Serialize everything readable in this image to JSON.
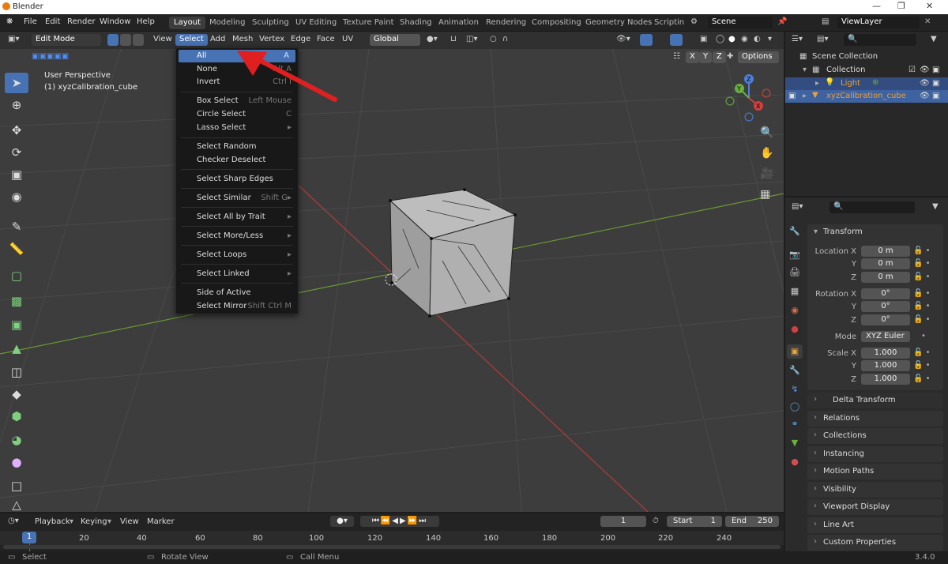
{
  "window": {
    "title": "Blender"
  },
  "menubar": {
    "items": [
      "File",
      "Edit",
      "Render",
      "Window",
      "Help"
    ],
    "workspaces": [
      "Layout",
      "Modeling",
      "Sculpting",
      "UV Editing",
      "Texture Paint",
      "Shading",
      "Animation",
      "Rendering",
      "Compositing",
      "Geometry Nodes",
      "Scripting"
    ],
    "active_workspace": "Layout",
    "scene": "Scene",
    "view_layer": "ViewLayer"
  },
  "header3d": {
    "mode": "Edit Mode",
    "menus": [
      "View",
      "Select",
      "Add",
      "Mesh",
      "Vertex",
      "Edge",
      "Face",
      "UV"
    ],
    "active_menu": "Select",
    "orientation": "Global",
    "options": "Options",
    "axes": [
      "X",
      "Y",
      "Z"
    ]
  },
  "viewport": {
    "perspective": "User Perspective",
    "object_label": "(1) xyzCalibration_cube"
  },
  "select_menu": {
    "items": [
      {
        "label": "All",
        "shortcut": "A",
        "highlighted": true
      },
      {
        "label": "None",
        "shortcut": "Alt A"
      },
      {
        "label": "Invert",
        "shortcut": "Ctrl I"
      },
      {
        "sep": true
      },
      {
        "label": "Box Select",
        "shortcut": "Left Mouse"
      },
      {
        "label": "Circle Select",
        "shortcut": "C"
      },
      {
        "label": "Lasso Select",
        "shortcut": "▸"
      },
      {
        "sep": true
      },
      {
        "label": "Select Random",
        "shortcut": ""
      },
      {
        "label": "Checker Deselect",
        "shortcut": ""
      },
      {
        "sep": true
      },
      {
        "label": "Select Sharp Edges",
        "shortcut": ""
      },
      {
        "sep": true
      },
      {
        "label": "Select Similar",
        "shortcut": "Shift G▸"
      },
      {
        "sep": true
      },
      {
        "label": "Select All by Trait",
        "shortcut": "▸"
      },
      {
        "sep": true
      },
      {
        "label": "Select More/Less",
        "shortcut": "▸"
      },
      {
        "sep": true
      },
      {
        "label": "Select Loops",
        "shortcut": "▸"
      },
      {
        "sep": true
      },
      {
        "label": "Select Linked",
        "shortcut": "▸"
      },
      {
        "sep": true
      },
      {
        "label": "Side of Active",
        "shortcut": ""
      },
      {
        "label": "Select Mirror",
        "shortcut": "Shift Ctrl M"
      }
    ]
  },
  "outliner": {
    "root": "Scene Collection",
    "collection": "Collection",
    "items": [
      "Light",
      "xyzCalibration_cube"
    ]
  },
  "properties": {
    "section": "Transform",
    "location": {
      "label": "Location X",
      "y": "Y",
      "z": "Z",
      "values": [
        "0 m",
        "0 m",
        "0 m"
      ]
    },
    "rotation": {
      "label": "Rotation X",
      "y": "Y",
      "z": "Z",
      "values": [
        "0°",
        "0°",
        "0°"
      ]
    },
    "mode_label": "Mode",
    "mode_value": "XYZ Euler",
    "scale": {
      "label": "Scale X",
      "y": "Y",
      "z": "Z",
      "values": [
        "1.000",
        "1.000",
        "1.000"
      ]
    },
    "delta": "Delta Transform",
    "panels": [
      "Relations",
      "Collections",
      "Instancing",
      "Motion Paths",
      "Visibility",
      "Viewport Display",
      "Line Art",
      "Custom Properties"
    ]
  },
  "timeline": {
    "menus": [
      "Playback",
      "Keying",
      "View",
      "Marker"
    ],
    "current_frame": "1",
    "start_label": "Start",
    "start": "1",
    "end_label": "End",
    "end": "250",
    "ticks": [
      "20",
      "40",
      "60",
      "80",
      "100",
      "120",
      "140",
      "160",
      "180",
      "200",
      "220",
      "240"
    ],
    "frame_marker": "1"
  },
  "statusbar": {
    "items": [
      "Select",
      "Rotate View",
      "Call Menu"
    ],
    "version": "3.4.0"
  },
  "colors": {
    "accent": "#4772b3",
    "arrow": "#e02020",
    "light": "#e8a23a"
  }
}
